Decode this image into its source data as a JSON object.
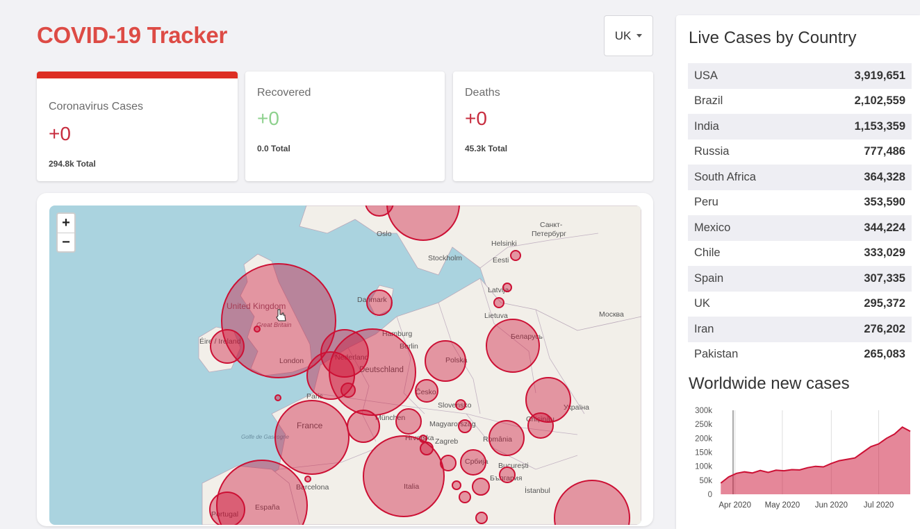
{
  "app": {
    "title": "COVID-19 Tracker"
  },
  "country_selector": {
    "value": "UK"
  },
  "stats": {
    "cases": {
      "label": "Coronavirus Cases",
      "value": "+0",
      "total": "294.8k Total"
    },
    "recovered": {
      "label": "Recovered",
      "value": "+0",
      "total": "0.0 Total"
    },
    "deaths": {
      "label": "Deaths",
      "value": "+0",
      "total": "45.3k Total"
    }
  },
  "colors": {
    "brand_red": "#dd4b45",
    "card_accent": "#dd2e23",
    "cases_value": "#c72c3e",
    "recovered_value": "#8ed18e",
    "circle_fill": "rgba(204,16,52,0.4)",
    "circle_stroke": "#cc1034",
    "map_water": "#aad3df",
    "map_land": "#f2efe9"
  },
  "map": {
    "zoom_in": "+",
    "zoom_out": "−",
    "labels": [
      "Oslo",
      "Stockholm",
      "Helsinki",
      "Санкт-",
      "Петербург",
      "Eesti",
      "Latvija",
      "Lietuva",
      "Москва",
      "Danmark",
      "United Kingdom",
      "Great Britain",
      "Éire / Ireland",
      "London",
      "Hamburg",
      "Berlin",
      "Nederland",
      "Deutschland",
      "Polska",
      "Беларусь",
      "Česko",
      "Paris",
      "France",
      "München",
      "Slovensko",
      "Magyarország",
      "Україна",
      "Chișinău",
      "Zagreb",
      "Hrvatska",
      "România",
      "Србија",
      "București",
      "България",
      "Italia",
      "Barcelona",
      "España",
      "Portugal",
      "İstanbul",
      "Golfe de Gascogne"
    ]
  },
  "live_cases": {
    "title": "Live Cases by Country",
    "rows": [
      {
        "country": "USA",
        "cases": "3,919,651"
      },
      {
        "country": "Brazil",
        "cases": "2,102,559"
      },
      {
        "country": "India",
        "cases": "1,153,359"
      },
      {
        "country": "Russia",
        "cases": "777,486"
      },
      {
        "country": "South Africa",
        "cases": "364,328"
      },
      {
        "country": "Peru",
        "cases": "353,590"
      },
      {
        "country": "Mexico",
        "cases": "344,224"
      },
      {
        "country": "Chile",
        "cases": "333,029"
      },
      {
        "country": "Spain",
        "cases": "307,335"
      },
      {
        "country": "UK",
        "cases": "295,372"
      },
      {
        "country": "Iran",
        "cases": "276,202"
      },
      {
        "country": "Pakistan",
        "cases": "265,083"
      }
    ]
  },
  "chart_data": {
    "type": "area",
    "title": "Worldwide new cases",
    "xlabel": "",
    "ylabel": "",
    "ylim": [
      0,
      300000
    ],
    "yticks": [
      0,
      50000,
      100000,
      150000,
      200000,
      250000,
      300000
    ],
    "ytick_labels": [
      "0",
      "50k",
      "100k",
      "150k",
      "200k",
      "250k",
      "300k"
    ],
    "xticks": [
      "2020-04-01",
      "2020-05-01",
      "2020-06-01",
      "2020-07-01"
    ],
    "xtick_labels": [
      "Apr 2020",
      "May 2020",
      "Jun 2020",
      "Jul 2020"
    ],
    "xlim": [
      "2020-03-22",
      "2020-07-21"
    ],
    "grid": "vertical",
    "color": "#cc1034",
    "fill": "rgba(204,16,52,0.5)",
    "x": [
      "2020-03-23",
      "2020-03-28",
      "2020-04-02",
      "2020-04-07",
      "2020-04-12",
      "2020-04-17",
      "2020-04-22",
      "2020-04-27",
      "2020-05-02",
      "2020-05-07",
      "2020-05-12",
      "2020-05-17",
      "2020-05-22",
      "2020-05-27",
      "2020-06-01",
      "2020-06-06",
      "2020-06-11",
      "2020-06-16",
      "2020-06-21",
      "2020-06-26",
      "2020-07-01",
      "2020-07-06",
      "2020-07-11",
      "2020-07-16",
      "2020-07-21"
    ],
    "values": [
      40000,
      62000,
      75000,
      80000,
      76000,
      85000,
      78000,
      86000,
      84000,
      88000,
      87000,
      95000,
      100000,
      98000,
      110000,
      120000,
      125000,
      130000,
      150000,
      170000,
      180000,
      200000,
      215000,
      240000,
      225000
    ]
  }
}
